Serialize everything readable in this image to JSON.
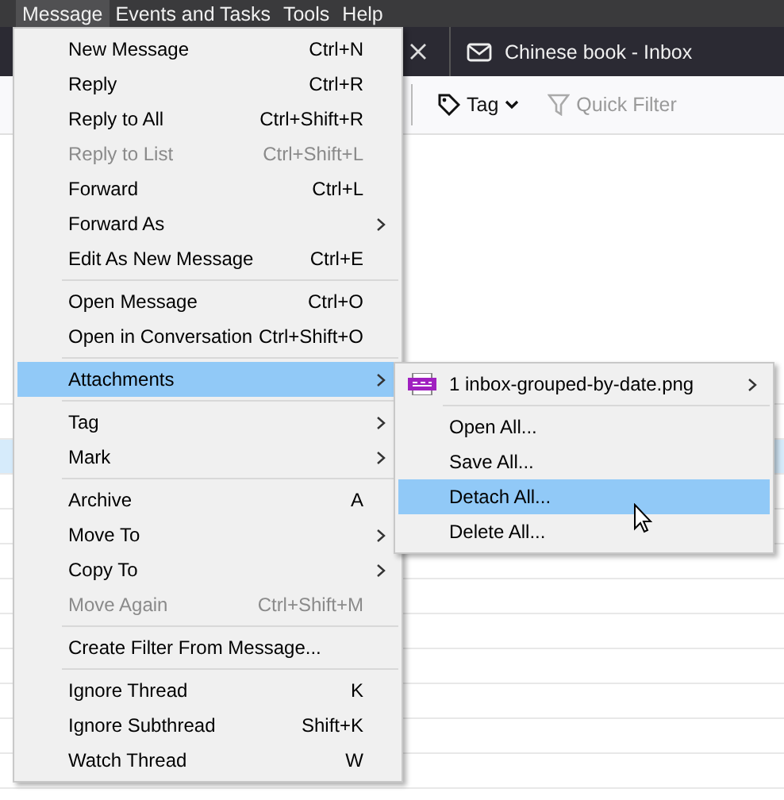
{
  "menubar": [
    {
      "label": "Message",
      "selected": true
    },
    {
      "label": "Events and Tasks",
      "selected": false
    },
    {
      "label": "Tools",
      "selected": false
    },
    {
      "label": "Help",
      "selected": false
    }
  ],
  "tabs": [
    {
      "label": "Chinese book - Inbox",
      "selected": false
    }
  ],
  "toolbar": {
    "tag_button": "Tag",
    "quick_filter": {
      "label": "Quick Filter",
      "disabled": true
    }
  },
  "message_list": {
    "rows": [
      {
        "selected": false
      },
      {
        "selected": false
      },
      {
        "selected": true
      },
      {
        "selected": false
      },
      {
        "selected": false
      },
      {
        "selected": false
      },
      {
        "selected": false
      },
      {
        "selected": false
      },
      {
        "selected": false
      },
      {
        "selected": false
      },
      {
        "selected": false
      },
      {
        "selected": false
      }
    ]
  },
  "menu": [
    {
      "kind": "item",
      "label": "New Message",
      "shortcut": "Ctrl+N",
      "submenu": false,
      "disabled": false,
      "selected": false
    },
    {
      "kind": "item",
      "label": "Reply",
      "shortcut": "Ctrl+R",
      "submenu": false,
      "disabled": false,
      "selected": false
    },
    {
      "kind": "item",
      "label": "Reply to All",
      "shortcut": "Ctrl+Shift+R",
      "submenu": false,
      "disabled": false,
      "selected": false
    },
    {
      "kind": "item",
      "label": "Reply to List",
      "shortcut": "Ctrl+Shift+L",
      "submenu": false,
      "disabled": true,
      "selected": false
    },
    {
      "kind": "item",
      "label": "Forward",
      "shortcut": "Ctrl+L",
      "submenu": false,
      "disabled": false,
      "selected": false
    },
    {
      "kind": "item",
      "label": "Forward As",
      "submenu": true,
      "disabled": false,
      "selected": false
    },
    {
      "kind": "item",
      "label": "Edit As New Message",
      "shortcut": "Ctrl+E",
      "submenu": false,
      "disabled": false,
      "selected": false
    },
    {
      "kind": "separator"
    },
    {
      "kind": "item",
      "label": "Open Message",
      "shortcut": "Ctrl+O",
      "submenu": false,
      "disabled": false,
      "selected": false
    },
    {
      "kind": "item",
      "label": "Open in Conversation",
      "shortcut": "Ctrl+Shift+O",
      "submenu": false,
      "disabled": false,
      "selected": false
    },
    {
      "kind": "separator"
    },
    {
      "kind": "item",
      "label": "Attachments",
      "submenu": true,
      "disabled": false,
      "selected": true
    },
    {
      "kind": "separator"
    },
    {
      "kind": "item",
      "label": "Tag",
      "submenu": true,
      "disabled": false,
      "selected": false
    },
    {
      "kind": "item",
      "label": "Mark",
      "submenu": true,
      "disabled": false,
      "selected": false
    },
    {
      "kind": "separator"
    },
    {
      "kind": "item",
      "label": "Archive",
      "shortcut": "A",
      "submenu": false,
      "disabled": false,
      "selected": false
    },
    {
      "kind": "item",
      "label": "Move To",
      "submenu": true,
      "disabled": false,
      "selected": false
    },
    {
      "kind": "item",
      "label": "Copy To",
      "submenu": true,
      "disabled": false,
      "selected": false
    },
    {
      "kind": "item",
      "label": "Move Again",
      "shortcut": "Ctrl+Shift+M",
      "submenu": false,
      "disabled": true,
      "selected": false
    },
    {
      "kind": "separator"
    },
    {
      "kind": "item",
      "label": "Create Filter From Message...",
      "submenu": false,
      "disabled": false,
      "selected": false
    },
    {
      "kind": "separator"
    },
    {
      "kind": "item",
      "label": "Ignore Thread",
      "shortcut": "K",
      "submenu": false,
      "disabled": false,
      "selected": false
    },
    {
      "kind": "item",
      "label": "Ignore Subthread",
      "shortcut": "Shift+K",
      "submenu": false,
      "disabled": false,
      "selected": false
    },
    {
      "kind": "item",
      "label": "Watch Thread",
      "shortcut": "W",
      "submenu": false,
      "disabled": false,
      "selected": false
    }
  ],
  "attachments_menu": [
    {
      "kind": "file",
      "label": "1 inbox-grouped-by-date.png",
      "submenu": true,
      "selected": false
    },
    {
      "kind": "separator"
    },
    {
      "kind": "item",
      "label": "Open All...",
      "submenu": false,
      "selected": false
    },
    {
      "kind": "item",
      "label": "Save All...",
      "submenu": false,
      "selected": false
    },
    {
      "kind": "item",
      "label": "Detach All...",
      "submenu": false,
      "selected": true
    },
    {
      "kind": "item",
      "label": "Delete All...",
      "submenu": false,
      "selected": false
    }
  ]
}
